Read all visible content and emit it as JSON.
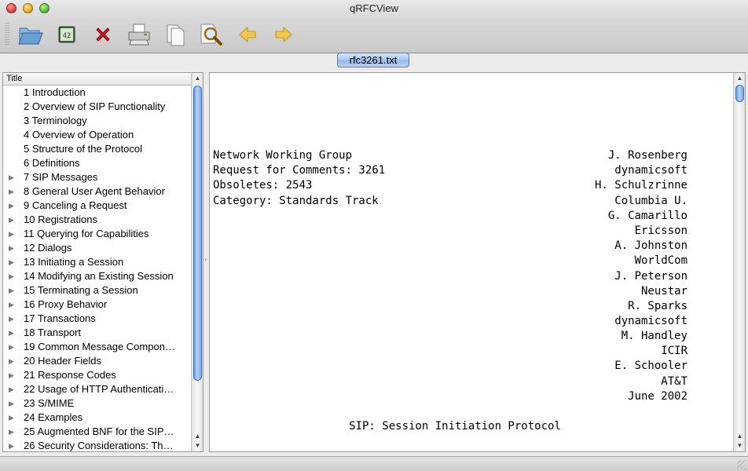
{
  "window": {
    "title": "qRFCView"
  },
  "toolbar": {
    "buttons": [
      {
        "name": "open-button",
        "icon": "folder-open-icon"
      },
      {
        "name": "goto-button",
        "icon": "number-42-icon"
      },
      {
        "name": "close-document-button",
        "icon": "red-x-icon"
      },
      {
        "name": "print-button",
        "icon": "printer-icon"
      },
      {
        "name": "copy-button",
        "icon": "copy-pages-icon"
      },
      {
        "name": "find-button",
        "icon": "magnifier-icon"
      },
      {
        "name": "back-button",
        "icon": "arrow-left-icon"
      },
      {
        "name": "forward-button",
        "icon": "arrow-right-icon"
      }
    ]
  },
  "tabs": [
    {
      "label": "rfc3261.txt",
      "active": true
    }
  ],
  "toc": {
    "column_header": "Title",
    "items": [
      {
        "label": "1 Introduction",
        "expandable": false
      },
      {
        "label": "2 Overview of SIP Functionality",
        "expandable": false
      },
      {
        "label": "3 Terminology",
        "expandable": false
      },
      {
        "label": "4 Overview of Operation",
        "expandable": false
      },
      {
        "label": "5 Structure of the Protocol",
        "expandable": false
      },
      {
        "label": "6 Definitions",
        "expandable": false
      },
      {
        "label": "7 SIP Messages",
        "expandable": true
      },
      {
        "label": "8 General User Agent Behavior",
        "expandable": true
      },
      {
        "label": "9 Canceling a Request",
        "expandable": true
      },
      {
        "label": "10 Registrations",
        "expandable": true
      },
      {
        "label": "11 Querying for Capabilities",
        "expandable": true
      },
      {
        "label": "12 Dialogs",
        "expandable": true
      },
      {
        "label": "13 Initiating a Session",
        "expandable": true
      },
      {
        "label": "14 Modifying an Existing Session",
        "expandable": true
      },
      {
        "label": "15 Terminating a Session",
        "expandable": true
      },
      {
        "label": "16 Proxy Behavior",
        "expandable": true
      },
      {
        "label": "17 Transactions",
        "expandable": true
      },
      {
        "label": "18 Transport",
        "expandable": true
      },
      {
        "label": "19 Common Message Compon…",
        "expandable": true
      },
      {
        "label": "20 Header Fields",
        "expandable": true
      },
      {
        "label": "21 Response Codes",
        "expandable": true
      },
      {
        "label": "22 Usage of HTTP Authenticati…",
        "expandable": true
      },
      {
        "label": "23 S/MIME",
        "expandable": true
      },
      {
        "label": "24 Examples",
        "expandable": true
      },
      {
        "label": "25  Augmented BNF for the SIP…",
        "expandable": true
      },
      {
        "label": "26 Security Considerations: Th…",
        "expandable": true
      }
    ]
  },
  "document": {
    "left_lines": [
      "Network Working Group",
      "Request for Comments: 3261",
      "Obsoletes: 2543",
      "Category: Standards Track"
    ],
    "right_lines": [
      "J. Rosenberg",
      "dynamicsoft",
      "H. Schulzrinne",
      "Columbia U.",
      "G. Camarillo",
      "Ericsson",
      "A. Johnston",
      "WorldCom",
      "J. Peterson",
      "Neustar",
      "R. Sparks",
      "dynamicsoft",
      "M. Handley",
      "ICIR",
      "E. Schooler",
      "AT&T",
      "June 2002"
    ],
    "title_line": "SIP: Session Initiation Protocol"
  }
}
